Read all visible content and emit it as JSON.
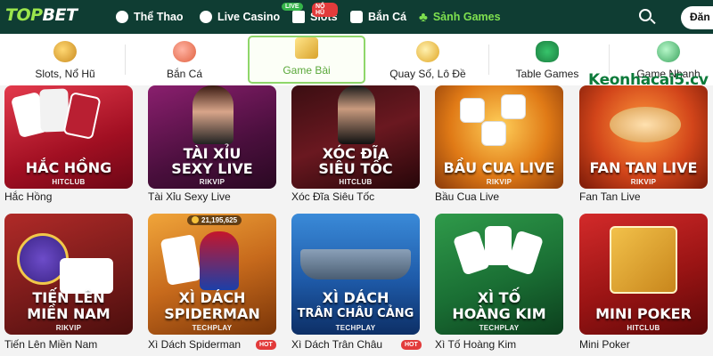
{
  "brand": {
    "name_part1": "TOP",
    "name_part2": "BET"
  },
  "nav": {
    "items": [
      {
        "label": "Thể Thao",
        "icon": "soccer-ball-icon"
      },
      {
        "label": "Live Casino",
        "icon": "chip-icon",
        "badge": "LIVE"
      },
      {
        "label": "Slots",
        "icon": "seven-icon",
        "badge": "NỔ HŨ"
      },
      {
        "label": "Bắn Cá",
        "icon": "fish-icon"
      },
      {
        "label": "Sảnh Games",
        "icon": "club-icon",
        "active": true
      }
    ],
    "login_label": "Đăn"
  },
  "categories": [
    {
      "label": "Slots, Nổ Hũ"
    },
    {
      "label": "Bắn Cá"
    },
    {
      "label": "Game Bài",
      "active": true
    },
    {
      "label": "Quay Số, Lô Đề"
    },
    {
      "label": "Table Games"
    },
    {
      "label": "Game Nhanh"
    }
  ],
  "watermark": "Keonhacai5.cv",
  "games": [
    {
      "name": "Hắc Hồng",
      "title1": "HẮC HỒNG",
      "title2": "",
      "provider": "HITCLUB"
    },
    {
      "name": "Tài Xỉu Sexy Live",
      "title1": "TÀI XỈU",
      "title2": "SEXY LIVE",
      "provider": "RIKVIP"
    },
    {
      "name": "Xóc Đĩa Siêu Tốc",
      "title1": "XÓC ĐĨA",
      "title2": "SIÊU TỐC",
      "provider": "HITCLUB"
    },
    {
      "name": "Bầu Cua Live",
      "title1": "BẦU CUA LIVE",
      "title2": "",
      "provider": "RIKVIP"
    },
    {
      "name": "Fan Tan Live",
      "title1": "FAN TAN LIVE",
      "title2": "",
      "provider": "RIKVIP"
    },
    {
      "name": "Tiến Lên Miền Nam",
      "title1": "TIẾN LÊN",
      "title2": "MIỀN NAM",
      "provider": "RIKVIP"
    },
    {
      "name": "Xì Dách Spiderman",
      "title1": "XÌ DÁCH",
      "title2": "SPIDERMAN",
      "provider": "TECHPLAY",
      "hot": "HOT",
      "counter": "21,195,625"
    },
    {
      "name": "Xì Dách Trân Châu",
      "title1": "XÌ DÁCH",
      "title2": "TRÂN CHÂU CẢNG",
      "provider": "TECHPLAY",
      "hot": "HOT"
    },
    {
      "name": "Xì Tố Hoàng Kim",
      "title1": "XÌ TỐ",
      "title2": "HOÀNG KIM",
      "provider": "TECHPLAY"
    },
    {
      "name": "Mini Poker",
      "title1": "MINI POKER",
      "title2": "",
      "provider": "HITCLUB"
    }
  ],
  "colors": {
    "nav_bg": "#0f3d33",
    "accent_green": "#7ee04f",
    "hot_red": "#e23b3b"
  }
}
